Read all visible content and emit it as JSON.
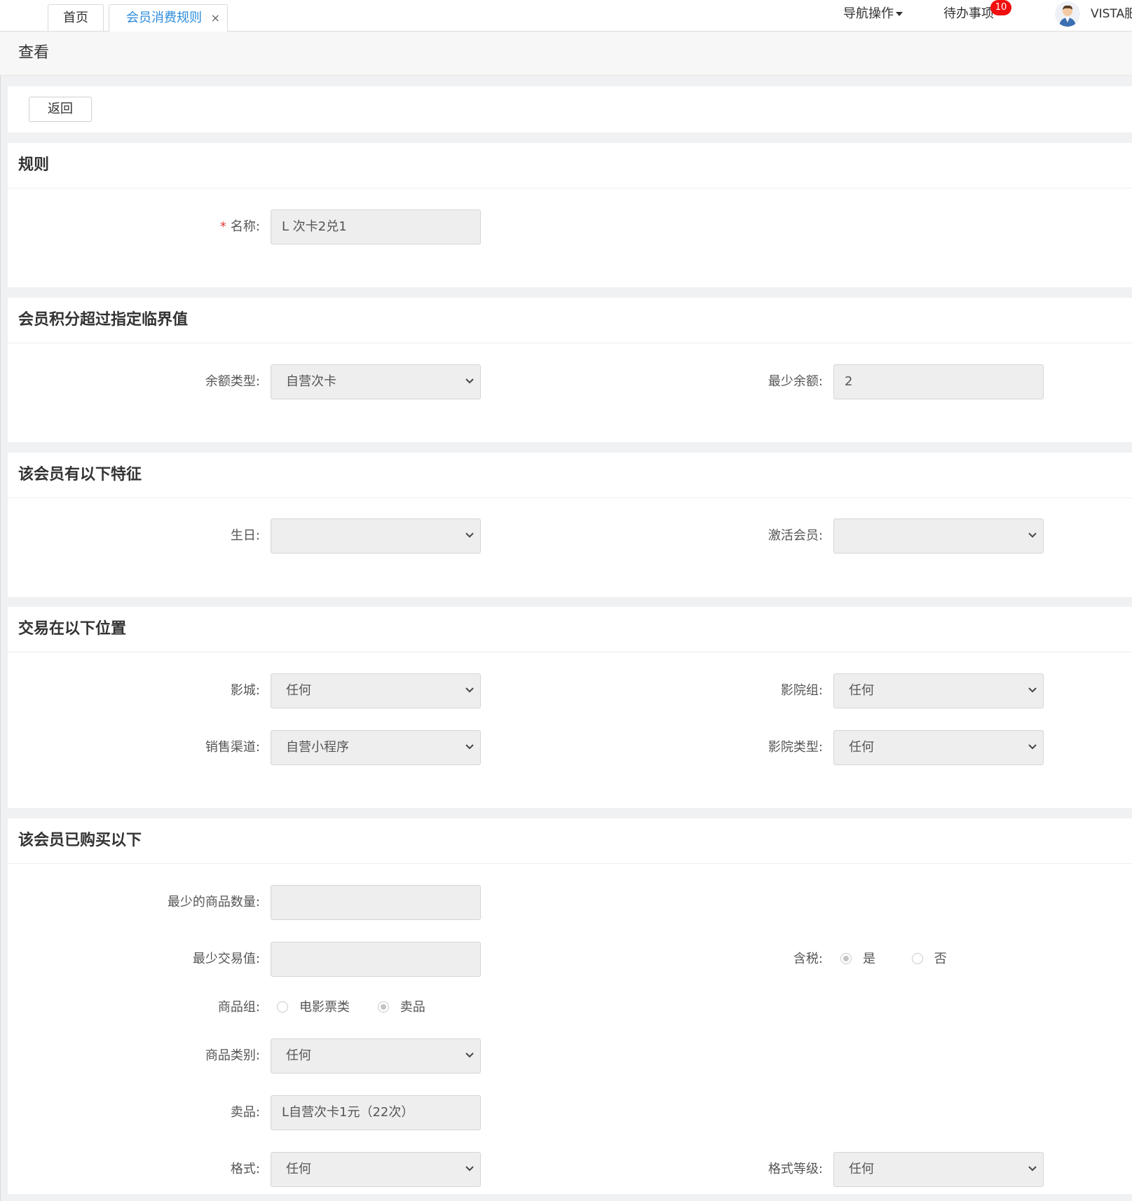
{
  "topbar": {
    "tabs": [
      {
        "label": "首页",
        "active": false
      },
      {
        "label": "会员消费规则",
        "active": true,
        "close": "×"
      }
    ],
    "nav_ops": "导航操作",
    "todo": "待办事项",
    "todo_count": "10",
    "username": "VISTA肥"
  },
  "page_title": "查看",
  "back_button": "返回",
  "sections": {
    "rule": {
      "title": "规则",
      "name_label": "名称:",
      "name_required": "*",
      "name_value": "L 次卡2兑1"
    },
    "threshold": {
      "title": "会员积分超过指定临界值",
      "balance_type_label": "余额类型:",
      "balance_type_value": "自营次卡",
      "min_balance_label": "最少余额:",
      "min_balance_value": "2"
    },
    "traits": {
      "title": "该会员有以下特征",
      "birthday_label": "生日:",
      "birthday_value": "",
      "activated_label": "激活会员:",
      "activated_value": ""
    },
    "location": {
      "title": "交易在以下位置",
      "cinema_label": "影城:",
      "cinema_value": "任何",
      "cinema_group_label": "影院组:",
      "cinema_group_value": "任何",
      "channel_label": "销售渠道:",
      "channel_value": "自营小程序",
      "cinema_type_label": "影院类型:",
      "cinema_type_value": "任何"
    },
    "purchase": {
      "title": "该会员已购买以下",
      "min_qty_label": "最少的商品数量:",
      "min_qty_value": "",
      "min_trans_label": "最少交易值:",
      "min_trans_value": "",
      "tax_label": "含税:",
      "tax_options": [
        {
          "label": "是",
          "checked": true
        },
        {
          "label": "否",
          "checked": false
        }
      ],
      "group_label": "商品组:",
      "group_options": [
        {
          "label": "电影票类",
          "checked": false
        },
        {
          "label": "卖品",
          "checked": true
        }
      ],
      "category_label": "商品类别:",
      "category_value": "任何",
      "product_label": "卖品:",
      "product_value": "L自营次卡1元（22次）",
      "format_label": "格式:",
      "format_value": "任何",
      "format_level_label": "格式等级:",
      "format_level_value": "任何"
    }
  }
}
